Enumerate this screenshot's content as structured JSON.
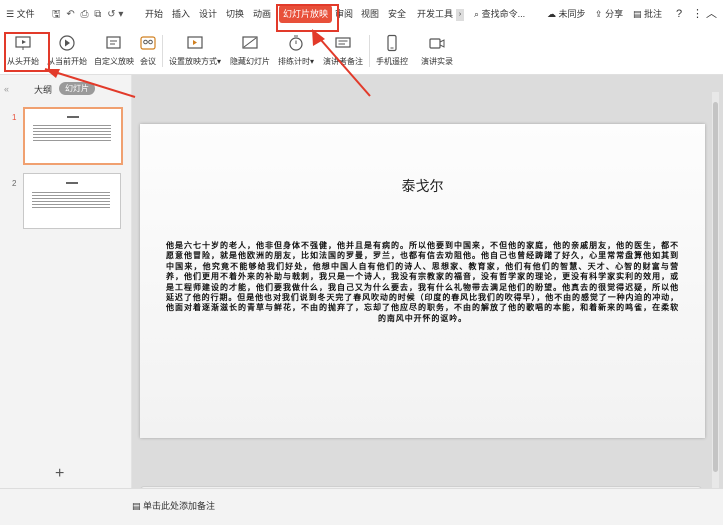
{
  "menu": {
    "file_label": "文件",
    "tabs": [
      "开始",
      "插入",
      "设计",
      "切换",
      "动画",
      "幻灯片放映",
      "审阅",
      "视图",
      "安全",
      "开发工具"
    ],
    "active_tab": "幻灯片放映",
    "search_label": "查找命令...",
    "sync_label": "未同步",
    "share_label": "分享",
    "comment_label": "批注",
    "help_label": "?"
  },
  "ribbon": {
    "buttons": [
      {
        "label": "从头开始",
        "icon": "screen-play-icon"
      },
      {
        "label": "从当前开始",
        "icon": "circle-play-icon"
      },
      {
        "label": "自定义放映",
        "icon": "custom-show-icon"
      },
      {
        "label": "会议",
        "icon": "meeting-icon"
      },
      {
        "label": "设置放映方式",
        "icon": "setup-show-icon"
      },
      {
        "label": "隐藏幻灯片",
        "icon": "hide-slide-icon"
      },
      {
        "label": "排练计时",
        "icon": "timer-icon"
      },
      {
        "label": "演讲者备注",
        "icon": "speaker-notes-icon"
      },
      {
        "label": "手机遥控",
        "icon": "phone-remote-icon"
      },
      {
        "label": "演讲实录",
        "icon": "record-icon"
      }
    ]
  },
  "left_panel": {
    "tab_outline": "大纲",
    "tab_slides": "幻灯片",
    "slide_numbers": [
      "1",
      "2"
    ],
    "add_button": "+"
  },
  "slide": {
    "title": "泰戈尔",
    "body": "他是六七十岁的老人，他非但身体不强健，他并且是有病的。所以他要到中国来，不但他的家庭，他的亲戚朋友，他的医生，都不愿意他冒险，就是他欧洲的朋友，比如法国的罗曼，罗兰，也都有信去劝阻他。他自己也曾经踌躇了好久，心里常常盘算他如其到中国来，他究竟不能够给我们好处，他想中国人自有他们的诗人、思想家、教育家，他们有他们的智慧、天才、心智的财富与营养，他们更用不着外来的补助与戟刺，我只是一个诗人，我没有宗教家的福音，没有哲学家的理论，更没有科学家实利的效用，或是工程师建设的才能，他们要我做什么，我自己又为什么要去，我有什么礼物带去满足他们的盼望。他真去的很觉得迟疑，所以他延迟了他的行期。但是他也对我们说到冬天完了春风吹动的时候（印度的春风比我们的吹得早），他不由的感觉了一种内迫的冲动，他面对着逐渐滋长的青草与鲜花，不由的抛弃了，忘却了他应尽的职务，不由的解放了他的歌唱的本能，和着新来的鸣雀，在柔软的南风中开怀的讴吟。"
  },
  "notes": {
    "placeholder": "单击此处添加备注"
  },
  "colors": {
    "accent": "#e8503a",
    "annotation_red": "#e23a2a",
    "thumb_selected": "#f0a070"
  }
}
